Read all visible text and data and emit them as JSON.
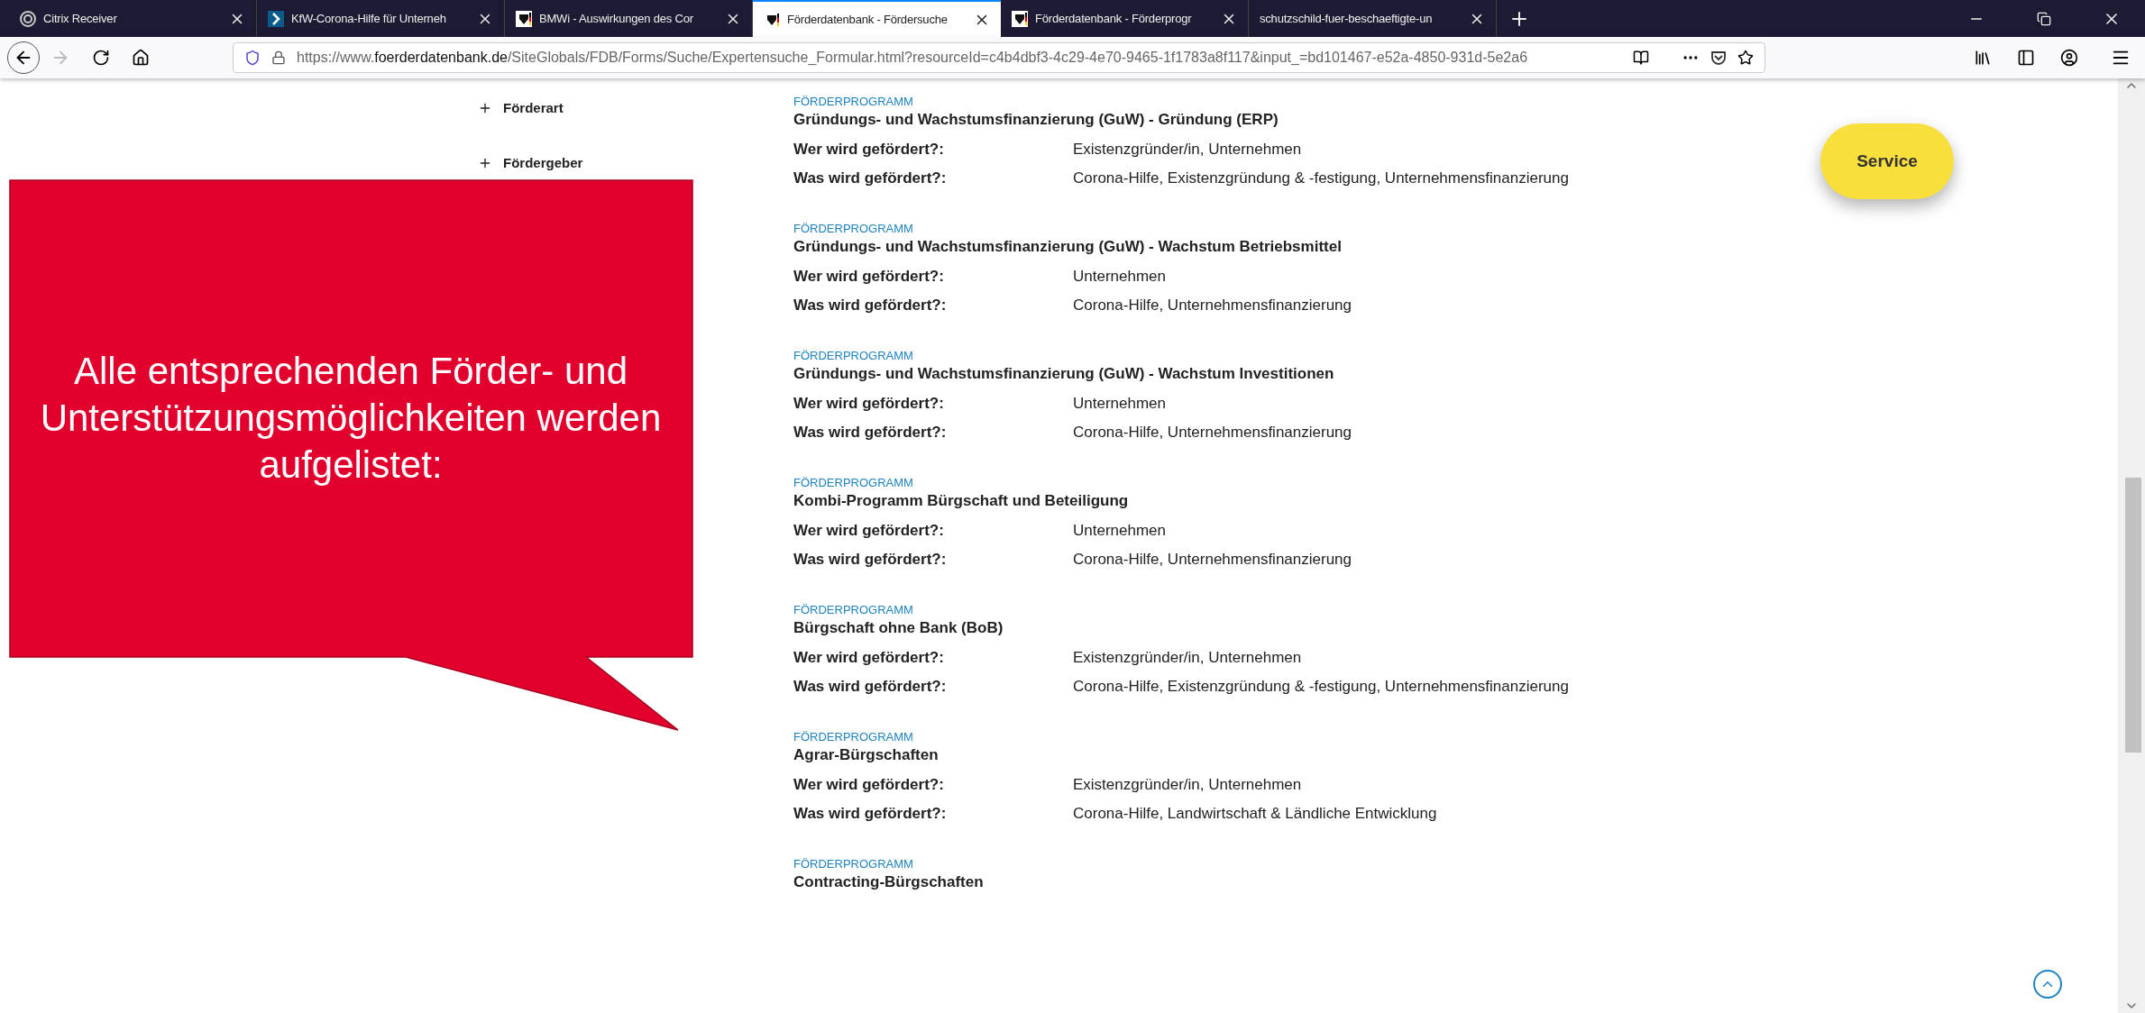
{
  "browser": {
    "tabs": [
      {
        "title": "Citrix Receiver",
        "selected": false
      },
      {
        "title": "KfW-Corona-Hilfe für Unterneh",
        "selected": false
      },
      {
        "title": "BMWi - Auswirkungen des Cor",
        "selected": false
      },
      {
        "title": "Förderdatenbank - Fördersuche",
        "selected": true
      },
      {
        "title": "Förderdatenbank - Förderprogr",
        "selected": false
      },
      {
        "title": "schutzschild-fuer-beschaeftigte-un",
        "selected": false
      }
    ],
    "url": {
      "prefix": "https://www.",
      "domain": "foerderdatenbank.de",
      "rest": "/SiteGlobals/FDB/Forms/Suche/Expertensuche_Formular.html?resourceId=c4b4dbf3-4c29-4e70-9465-1f1783a8f117&input_=bd101467-e52a-4850-931d-5e2a6"
    },
    "forward_disabled": true
  },
  "filters": [
    {
      "label": "Förderart",
      "expanded": false
    },
    {
      "label": "Fördergeber",
      "expanded": false
    }
  ],
  "service_button": "Service",
  "results": [
    {
      "type": "FÖRDERPROGRAMM",
      "title": "Gründungs- und Wachstumsfinanzierung (GuW) - Gründung (ERP)",
      "fields": [
        {
          "label": "Wer wird gefördert?:",
          "value": "Existenzgründer/in, Unternehmen"
        },
        {
          "label": "Was wird gefördert?:",
          "value": "Corona-Hilfe, Existenzgründung & -festigung, Unternehmensfinanzierung"
        }
      ]
    },
    {
      "type": "FÖRDERPROGRAMM",
      "title": "Gründungs- und Wachstumsfinanzierung (GuW) - Wachstum Betriebsmittel",
      "fields": [
        {
          "label": "Wer wird gefördert?:",
          "value": "Unternehmen"
        },
        {
          "label": "Was wird gefördert?:",
          "value": "Corona-Hilfe, Unternehmensfinanzierung"
        }
      ]
    },
    {
      "type": "FÖRDERPROGRAMM",
      "title": "Gründungs- und Wachstumsfinanzierung (GuW) - Wachstum Investitionen",
      "fields": [
        {
          "label": "Wer wird gefördert?:",
          "value": "Unternehmen"
        },
        {
          "label": "Was wird gefördert?:",
          "value": "Corona-Hilfe, Unternehmensfinanzierung"
        }
      ]
    },
    {
      "type": "FÖRDERPROGRAMM",
      "title": "Kombi-Programm Bürgschaft und Beteiligung",
      "fields": [
        {
          "label": "Wer wird gefördert?:",
          "value": "Unternehmen"
        },
        {
          "label": "Was wird gefördert?:",
          "value": "Corona-Hilfe, Unternehmensfinanzierung"
        }
      ]
    },
    {
      "type": "FÖRDERPROGRAMM",
      "title": "Bürgschaft ohne Bank (BoB)",
      "fields": [
        {
          "label": "Wer wird gefördert?:",
          "value": "Existenzgründer/in, Unternehmen"
        },
        {
          "label": "Was wird gefördert?:",
          "value": "Corona-Hilfe, Existenzgründung & -festigung, Unternehmensfinanzierung"
        }
      ]
    },
    {
      "type": "FÖRDERPROGRAMM",
      "title": "Agrar-Bürgschaften",
      "fields": [
        {
          "label": "Wer wird gefördert?:",
          "value": "Existenzgründer/in, Unternehmen"
        },
        {
          "label": "Was wird gefördert?:",
          "value": "Corona-Hilfe, Landwirtschaft & Ländliche Entwicklung"
        }
      ]
    },
    {
      "type": "FÖRDERPROGRAMM",
      "title": "Contracting-Bürgschaften"
    }
  ],
  "callout": {
    "text": "Alle entsprechenden Förder- und Unterstützungsmöglichkeiten werden aufgelistet:"
  }
}
